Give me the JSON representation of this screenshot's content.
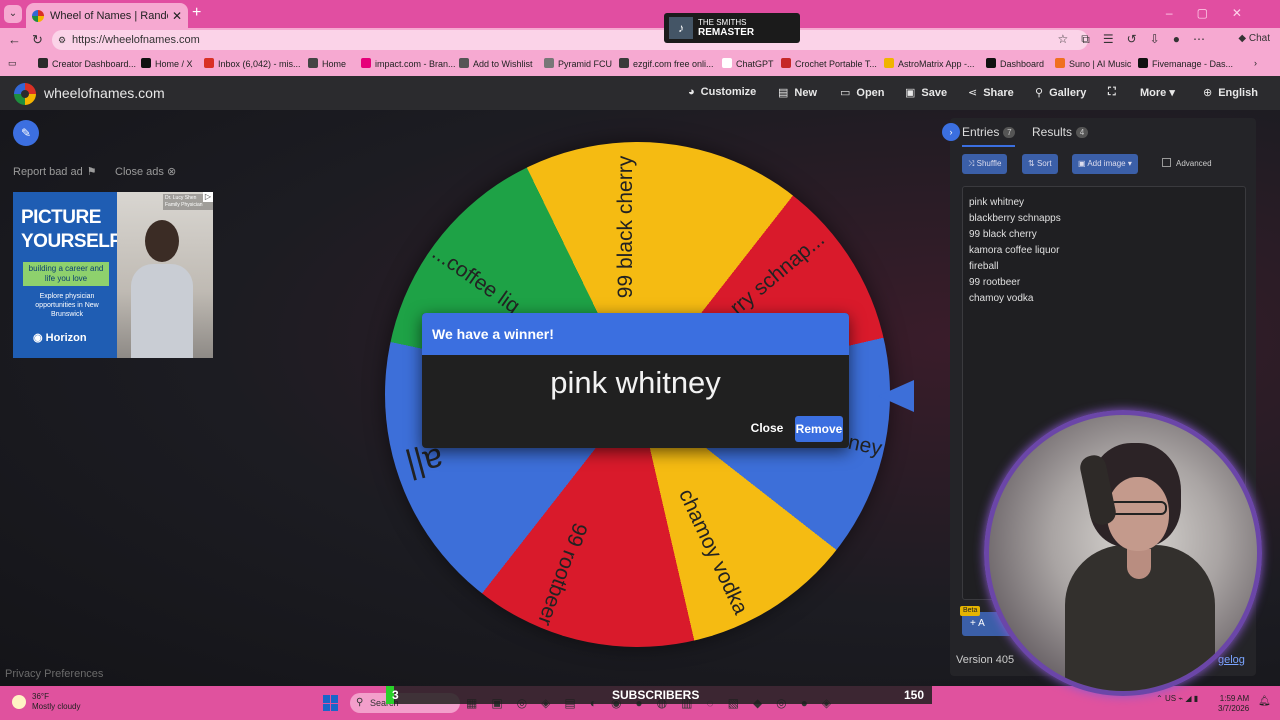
{
  "browser": {
    "tab_title": "Wheel of Names | Random name",
    "url": "https://wheelofnames.com",
    "bookmarks": [
      {
        "label": "Creator Dashboard...",
        "color": "#2a2a2a"
      },
      {
        "label": "Home / X",
        "color": "#111111"
      },
      {
        "label": "Inbox (6,042) - mis...",
        "color": "#d93025"
      },
      {
        "label": "Home",
        "color": "#444444"
      },
      {
        "label": "impact.com - Bran...",
        "color": "#e6007a"
      },
      {
        "label": "Add to Wishlist",
        "color": "#555555"
      },
      {
        "label": "Pyramid FCU",
        "color": "#777777"
      },
      {
        "label": "ezgif.com free onli...",
        "color": "#3a3a3a"
      },
      {
        "label": "ChatGPT",
        "color": "#ffffff"
      },
      {
        "label": "Crochet Portable T...",
        "color": "#c62828"
      },
      {
        "label": "AstroMatrix App -...",
        "color": "#f0b400"
      },
      {
        "label": "Dashboard",
        "color": "#111111"
      },
      {
        "label": "Suno | AI Music",
        "color": "#f07020"
      },
      {
        "label": "Fivemanage - Das...",
        "color": "#111111"
      }
    ],
    "chat_label": "Chat"
  },
  "now_playing": {
    "artist": "THE SMITHS",
    "title": "REMASTER"
  },
  "app": {
    "site_name": "wheelofnames.com",
    "menu": [
      {
        "label": "Customize",
        "icon": "palette-icon"
      },
      {
        "label": "New",
        "icon": "new-file-icon"
      },
      {
        "label": "Open",
        "icon": "folder-icon"
      },
      {
        "label": "Save",
        "icon": "save-icon"
      },
      {
        "label": "Share",
        "icon": "share-icon"
      },
      {
        "label": "Gallery",
        "icon": "search-icon"
      },
      {
        "label": "",
        "icon": "fullscreen-icon"
      },
      {
        "label": "More",
        "icon": "chevron-down-icon"
      },
      {
        "label": "English",
        "icon": "globe-icon"
      }
    ]
  },
  "left": {
    "report_label": "Report bad ad",
    "close_ads_label": "Close ads",
    "privacy_label": "Privacy Preferences",
    "ad": {
      "headline": "PICTURE YOURSELF",
      "pill": "building a career and life you love",
      "sub": "Explore physician opportunities in New Brunswick",
      "brand": "Horizon",
      "doctor": "Dr. Lucy Shen Family Physician"
    }
  },
  "wheel": {
    "segments": [
      "99 black cherry",
      "blackberry schnapps",
      "pink whitney",
      "chamoy vodka",
      "99 rootbeer",
      "fireball",
      "kamora coffee liquor"
    ],
    "visible_labels": [
      "99 black cherry",
      "rry schnap...",
      "ney",
      "chamoy vodka",
      "99 rootbeer",
      "||ɐ",
      "...coffee liq"
    ],
    "colors": {
      "yellow": "#f5bb12",
      "red": "#d91a2b",
      "blue": "#3d6fd9",
      "green": "#1ea246"
    }
  },
  "modal": {
    "title": "We have a winner!",
    "winner": "pink whitney",
    "close_label": "Close",
    "remove_label": "Remove"
  },
  "panel": {
    "tabs": [
      {
        "label": "Entries",
        "count": "7"
      },
      {
        "label": "Results",
        "count": "4"
      }
    ],
    "tools": {
      "shuffle": "Shuffle",
      "sort": "Sort",
      "add_image": "Add image",
      "advanced": "Advanced"
    },
    "entries": [
      "pink whitney",
      "blackberry schnapps",
      "99 black cherry",
      "kamora coffee liquor",
      "fireball",
      "99 rootbeer",
      "chamoy vodka"
    ],
    "beta": "Beta",
    "add_label": "A",
    "version": "Version 405",
    "changelog": "gelog"
  },
  "taskbar": {
    "temp": "36°F",
    "weather": "Mostly cloudy",
    "search": "Search",
    "subs_current": "3",
    "subs_label": "SUBSCRIBERS",
    "subs_goal": "150",
    "lang": "US",
    "time": "1:59 AM",
    "date": "3/7/2026"
  }
}
